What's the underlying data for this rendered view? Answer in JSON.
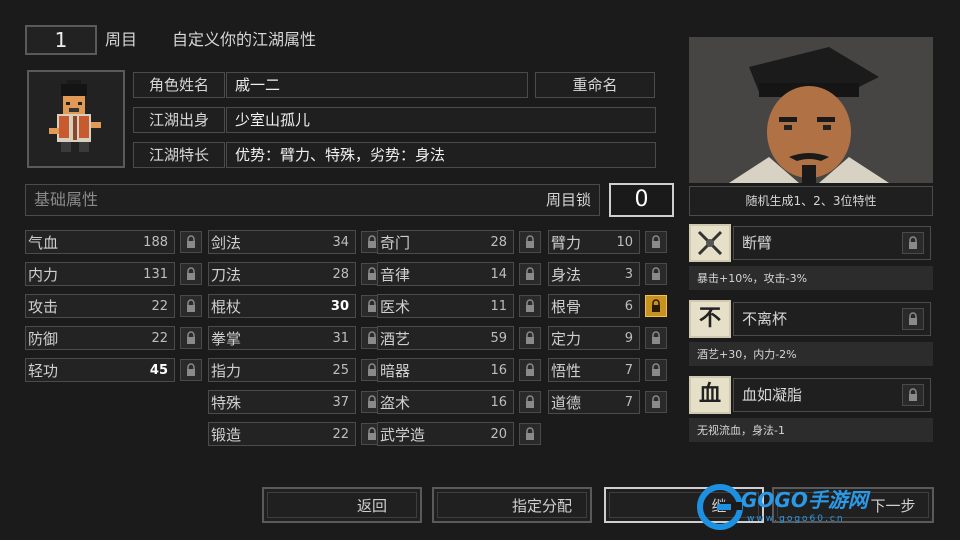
{
  "header": {
    "cycle_number": "1",
    "cycle_label": "周目",
    "title": "自定义你的江湖属性"
  },
  "profile": {
    "name_label": "角色姓名",
    "name_value": "戚一二",
    "rename_button": "重命名",
    "origin_label": "江湖出身",
    "origin_value": "少室山孤儿",
    "trait_label": "江湖特长",
    "trait_value": "优势：臂力、特殊，劣势：身法"
  },
  "base_attrs": {
    "label": "基础属性",
    "lock_label": "周目锁",
    "lock_value": "0"
  },
  "columns": [
    [
      {
        "name": "气血",
        "value": "188"
      },
      {
        "name": "内力",
        "value": "131"
      },
      {
        "name": "攻击",
        "value": "22"
      },
      {
        "name": "防御",
        "value": "22"
      },
      {
        "name": "轻功",
        "value": "45"
      }
    ],
    [
      {
        "name": "剑法",
        "value": "34"
      },
      {
        "name": "刀法",
        "value": "28"
      },
      {
        "name": "棍杖",
        "value": "30"
      },
      {
        "name": "拳掌",
        "value": "31"
      },
      {
        "name": "指力",
        "value": "25"
      },
      {
        "name": "特殊",
        "value": "37"
      },
      {
        "name": "锻造",
        "value": "22"
      }
    ],
    [
      {
        "name": "奇门",
        "value": "28"
      },
      {
        "name": "音律",
        "value": "14"
      },
      {
        "name": "医术",
        "value": "11"
      },
      {
        "name": "酒艺",
        "value": "59"
      },
      {
        "name": "暗器",
        "value": "16"
      },
      {
        "name": "盗术",
        "value": "16"
      },
      {
        "name": "武学造",
        "value": "20"
      }
    ],
    [
      {
        "name": "臂力",
        "value": "10"
      },
      {
        "name": "身法",
        "value": "3"
      },
      {
        "name": "根骨",
        "value": "6"
      },
      {
        "name": "定力",
        "value": "9"
      },
      {
        "name": "悟性",
        "value": "7"
      },
      {
        "name": "道德",
        "value": "7"
      }
    ]
  ],
  "traits_panel": {
    "header": "随机生成1、2、3位特性",
    "traits": [
      {
        "icon_char": "",
        "name": "断臂",
        "desc": "暴击+10%，攻击-3%"
      },
      {
        "icon_char": "不",
        "name": "不离杯",
        "desc": "酒艺+30，内力-2%"
      },
      {
        "icon_char": "血",
        "name": "血如凝脂",
        "desc": "无视流血，身法-1"
      }
    ]
  },
  "buttons": {
    "back": "返回",
    "assign": "指定分配",
    "continue": "继",
    "next": "下一步"
  },
  "watermark": {
    "brand": "GOGO手游网",
    "url": "www.gogo60.cn"
  },
  "colors": {
    "accent_gold": "#c79220",
    "border": "#5a5a5a"
  }
}
